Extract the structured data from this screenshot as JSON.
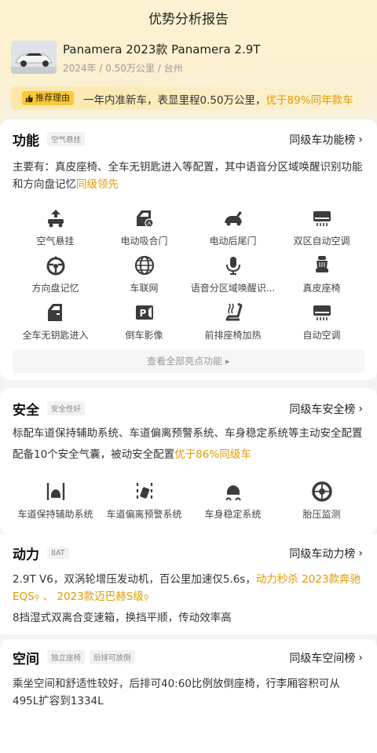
{
  "header": {
    "title": "优势分析报告"
  },
  "car": {
    "name": "Panamera 2023款 Panamera 2.9T",
    "meta": "2024年 / 0.50万公里 / 台州"
  },
  "reason": {
    "badge": "推荐理由",
    "text_prefix": "一年内准新车，表显里程0.50万公里，",
    "text_highlight": "优于89%同年款车"
  },
  "function_section": {
    "title": "功能",
    "tag": "空气悬挂",
    "link": "同级车功能榜",
    "desc_prefix": "主要有：真皮座椅、全车无钥匙进入等配置，其中语音分区域唤醒识别功能和方向盘记忆",
    "desc_highlight": "同级领先",
    "features": [
      {
        "label": "空气悬挂",
        "icon": "air-suspension-icon"
      },
      {
        "label": "电动吸合门",
        "icon": "soft-close-door-icon"
      },
      {
        "label": "电动后尾门",
        "icon": "power-tailgate-icon"
      },
      {
        "label": "双区自动空调",
        "icon": "dual-zone-ac-icon"
      },
      {
        "label": "方向盘记忆",
        "icon": "steering-memory-icon"
      },
      {
        "label": "车联网",
        "icon": "connected-car-icon"
      },
      {
        "label": "语音分区域唤醒识...",
        "icon": "voice-recognition-icon"
      },
      {
        "label": "真皮座椅",
        "icon": "leather-seat-icon"
      },
      {
        "label": "全车无钥匙进入",
        "icon": "keyless-entry-icon"
      },
      {
        "label": "倒车影像",
        "icon": "parking-camera-icon"
      },
      {
        "label": "前排座椅加热",
        "icon": "seat-heating-icon"
      },
      {
        "label": "自动空调",
        "icon": "auto-ac-icon"
      }
    ],
    "more_label": "查看全部亮点功能 ▸"
  },
  "safety_section": {
    "title": "安全",
    "tag": "安全性好",
    "link": "同级车安全榜",
    "line1": "标配车道保持辅助系统、车道偏离预警系统、车身稳定系统等主动安全配置",
    "line2_prefix": "配备10个安全气囊，被动安全配置",
    "line2_highlight": "优于86%同级车",
    "features": [
      {
        "label": "车道保持辅助系统",
        "icon": "lane-keep-icon"
      },
      {
        "label": "车道偏离预警系统",
        "icon": "lane-departure-icon"
      },
      {
        "label": "车身稳定系统",
        "icon": "stability-control-icon"
      },
      {
        "label": "胎压监测",
        "icon": "tire-pressure-icon"
      }
    ]
  },
  "power_section": {
    "title": "动力",
    "tag": "8AT",
    "link": "同级车动力榜",
    "line1_prefix": "2.9T V6，双涡轮增压发动机，百公里加速仅5.6s，",
    "line1_hl": "动力秒杀 2023款奔驰",
    "line2_hl_a": "EQS",
    "line2_sep": " 、 ",
    "line2_hl_b": "2023款迈巴赫S级",
    "line3": "8挡湿式双离合变速箱，换挡平顺，传动效率高"
  },
  "space_section": {
    "title": "空间",
    "tags": [
      "独立座椅",
      "后排可放倒"
    ],
    "link": "同级车空间榜",
    "desc": "乘坐空间和舒适性较好，后排可40:60比例放倒座椅，行李厢容积可从495L扩容到1334L"
  },
  "colors": {
    "accent": "#e39a00",
    "badge": "#fac83a",
    "icon": "#3c3c3c"
  }
}
